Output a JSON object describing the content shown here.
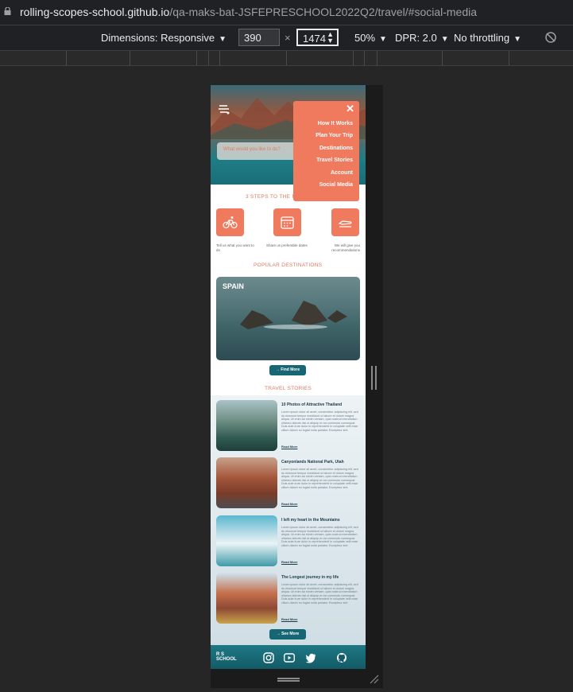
{
  "browser": {
    "url_host": "rolling-scopes-school.github.io",
    "url_path": "/qa-maks-bat-JSFEPRESCHOOL2022Q2/travel/#social-media"
  },
  "devtools": {
    "dimensions_label": "Dimensions: Responsive",
    "width": "390",
    "times": "×",
    "height": "1474",
    "zoom": "50%",
    "dpr": "DPR: 2.0",
    "throttling": "No throttling"
  },
  "page": {
    "search_placeholder": "What would you like to do?",
    "menu": {
      "close": "✕",
      "items": [
        "How It Works",
        "Plan Your Trip",
        "Destinations",
        "Travel Stories",
        "Account",
        "Social Media"
      ]
    },
    "steps_title": "3 STEPS TO THE R",
    "steps": [
      {
        "icon": "bicycle-icon",
        "text": "Tell us what you want to do"
      },
      {
        "icon": "calendar-icon",
        "text": "Share us preferable dates"
      },
      {
        "icon": "plane-icon",
        "text": "We will give you recommendations"
      }
    ],
    "popular_title": "POPULAR DESTINATIONS",
    "destination_name": "SPAIN",
    "find_more": "→ Find More",
    "stories_title": "TRAVEL STORIES",
    "stories": [
      {
        "title": "10 Photos of Attractive Thailand",
        "body": "Lorem ipsum dolor sit amet, consectetur adipiscing elit, sed do eiusmod tempor incididunt ut labore et dolore magna aliqua. Ut enim ad minim veniam, quis nostrud exercitation ullamco laboris nisi ut aliquip ex ea commodo consequat. Duis aute irure dolor in reprehenderit in voluptate velit esse cillum dolore eu fugiat nulla pariatur. Excepteur sint",
        "more": "Read More"
      },
      {
        "title": "Canyonlands National Park, Utah",
        "body": "Lorem ipsum dolor sit amet, consectetur adipiscing elit, sed do eiusmod tempor incididunt ut labore et dolore magna aliqua. Ut enim ad minim veniam, quis nostrud exercitation ullamco laboris nisi ut aliquip ex ea commodo consequat. Duis aute irure dolor in reprehenderit in voluptate velit esse cillum dolore eu fugiat nulla pariatur. Excepteur sint",
        "more": "Read More"
      },
      {
        "title": "I left my heart in the Mountains",
        "body": "Lorem ipsum dolor sit amet, consectetur adipiscing elit, sed do eiusmod tempor incididunt ut labore et dolore magna aliqua. Ut enim ad minim veniam, quis nostrud exercitation ullamco laboris nisi ut aliquip ex ea commodo consequat. Duis aute irure dolor in reprehenderit in voluptate velit esse cillum dolore eu fugiat nulla pariatur. Excepteur sint",
        "more": "Read More"
      },
      {
        "title": "The Longest journey in my life",
        "body": "Lorem ipsum dolor sit amet, consectetur adipiscing elit, sed do eiusmod tempor incididunt ut labore et dolore magna aliqua. Ut enim ad minim veniam, quis nostrud exercitation ullamco laboris nisi ut aliquip ex ea commodo consequat. Duis aute irure dolor in reprehenderit in voluptate velit esse cillum dolore eu fugiat nulla pariatur. Excepteur sint",
        "more": "Read More"
      }
    ],
    "see_more": "→ See More",
    "footer_logo": "R S\nSCHOOL",
    "footer_icons": [
      "instagram-icon",
      "youtube-icon",
      "twitter-icon",
      "github-icon"
    ]
  },
  "colors": {
    "accent": "#f07a5d",
    "teal": "#176674",
    "devtools_bg": "#202124"
  }
}
